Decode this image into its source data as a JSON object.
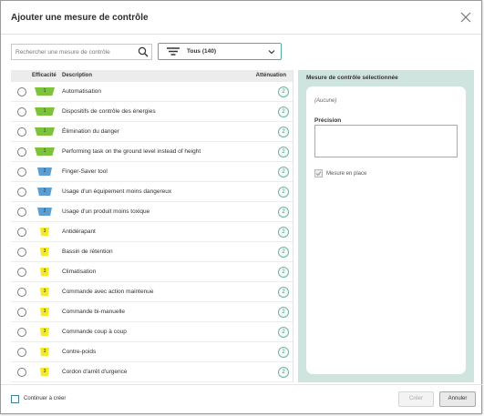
{
  "dialog": {
    "title": "Ajouter une mesure de contrôle"
  },
  "search": {
    "placeholder": "Rechercher une mesure de contrôle",
    "value": ""
  },
  "filter": {
    "selected": "Tous (140)"
  },
  "list": {
    "headers": {
      "effectiveness": "Efficacité",
      "description": "Description",
      "mitigation": "Atténuation"
    },
    "rows": [
      {
        "level": "1",
        "color": "#7cc23a",
        "desc": "Automatisation",
        "att": "2"
      },
      {
        "level": "1",
        "color": "#7cc23a",
        "desc": "Dispositifs de contrôle des énergies",
        "att": "2"
      },
      {
        "level": "1",
        "color": "#7cc23a",
        "desc": "Élimination du danger",
        "att": "2"
      },
      {
        "level": "1",
        "color": "#7cc23a",
        "desc": "Performing task on the ground level instead of height",
        "att": "2"
      },
      {
        "level": "2",
        "color": "#5b9ed1",
        "desc": "Finger-Saver tool",
        "att": "2"
      },
      {
        "level": "2",
        "color": "#5b9ed1",
        "desc": "Usage d'un équipement moins dangereux",
        "att": "2"
      },
      {
        "level": "2",
        "color": "#5b9ed1",
        "desc": "Usage d'un produit moins toxique",
        "att": "2"
      },
      {
        "level": "3",
        "color": "#f2ea2a",
        "desc": "Antidérapant",
        "att": "2"
      },
      {
        "level": "3",
        "color": "#f2ea2a",
        "desc": "Bassin de rétention",
        "att": "2"
      },
      {
        "level": "3",
        "color": "#f2ea2a",
        "desc": "Climatisation",
        "att": "2"
      },
      {
        "level": "3",
        "color": "#f2ea2a",
        "desc": "Commande avec action maintenue",
        "att": "2"
      },
      {
        "level": "3",
        "color": "#f2ea2a",
        "desc": "Commande bi-manuelle",
        "att": "2"
      },
      {
        "level": "3",
        "color": "#f2ea2a",
        "desc": "Commande coup à coup",
        "att": "2"
      },
      {
        "level": "3",
        "color": "#f2ea2a",
        "desc": "Contre-poids",
        "att": "2"
      },
      {
        "level": "3",
        "color": "#f2ea2a",
        "desc": "Cordon d'arrêt d'urgence",
        "att": "2"
      }
    ]
  },
  "side": {
    "title": "Mesure de contrôle sélectionnée",
    "none": "(Aucune)",
    "precision_label": "Précision",
    "precision_value": "",
    "in_place_label": "Mesure en place",
    "in_place_checked": true
  },
  "footer": {
    "continue_label": "Continuer à créer",
    "create_label": "Créer",
    "cancel_label": "Annuler"
  },
  "icons": {
    "close": "close-icon",
    "search": "search-icon",
    "filter": "filter-icon",
    "chevron": "chevron-down-icon",
    "check": "check-icon"
  },
  "colors": {
    "accent": "#5aab97",
    "side_panel": "#cfe3df",
    "level1": "#7cc23a",
    "level2": "#5b9ed1",
    "level3": "#f2ea2a"
  }
}
